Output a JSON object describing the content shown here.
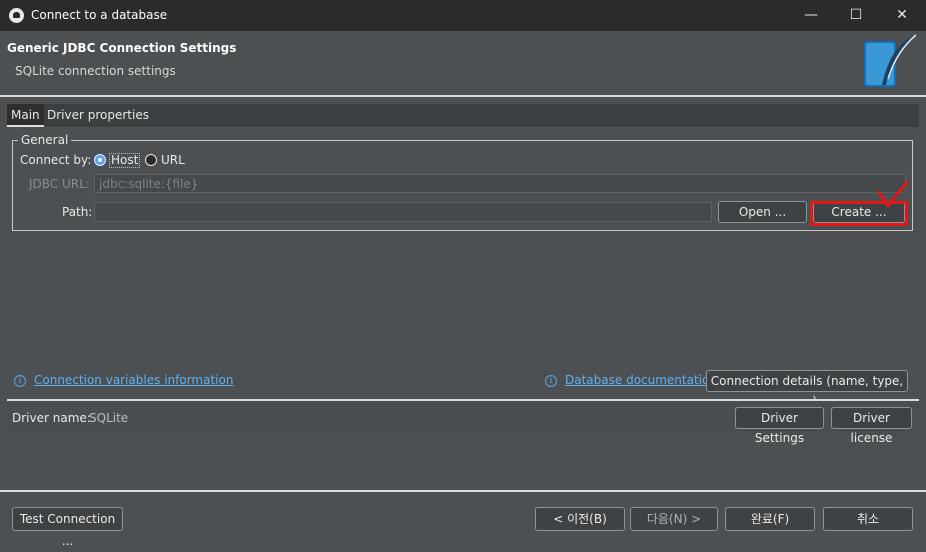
{
  "window": {
    "title": "Connect to a database",
    "controls": {
      "minimize": "—",
      "maximize": "☐",
      "close": "✕"
    }
  },
  "header": {
    "title": "Generic JDBC Connection Settings",
    "subtitle": "SQLite connection settings",
    "logo_icon": "sqlite-feather-icon"
  },
  "tabs": [
    {
      "label": "Main",
      "active": true
    },
    {
      "label": "Driver properties",
      "active": false
    }
  ],
  "general": {
    "group_label": "General",
    "connect_by_label": "Connect by:",
    "option_host": "Host",
    "option_url": "URL",
    "selected": "Host",
    "jdbc_url_label": "JDBC URL:",
    "jdbc_url_placeholder": "jdbc:sqlite:{file}",
    "path_label": "Path:",
    "path_value": "",
    "open_button": "Open ...",
    "create_button": "Create ..."
  },
  "links": {
    "connection_variables": "Connection variables information",
    "database_documentation": "Database documentation",
    "connection_details_button": "Connection details (name, type, ... )"
  },
  "driver": {
    "name_label": "Driver name:",
    "name_value": "SQLite",
    "settings_button": "Driver Settings",
    "license_button": "Driver license"
  },
  "footer": {
    "test_connection": "Test Connection ...",
    "back": "< 이전(B)",
    "next": "다음(N) >",
    "finish": "완료(F)",
    "cancel": "취소"
  },
  "colors": {
    "accent_link": "#5fb0f0",
    "annotation_red": "#e01818",
    "background": "#4c5052"
  }
}
